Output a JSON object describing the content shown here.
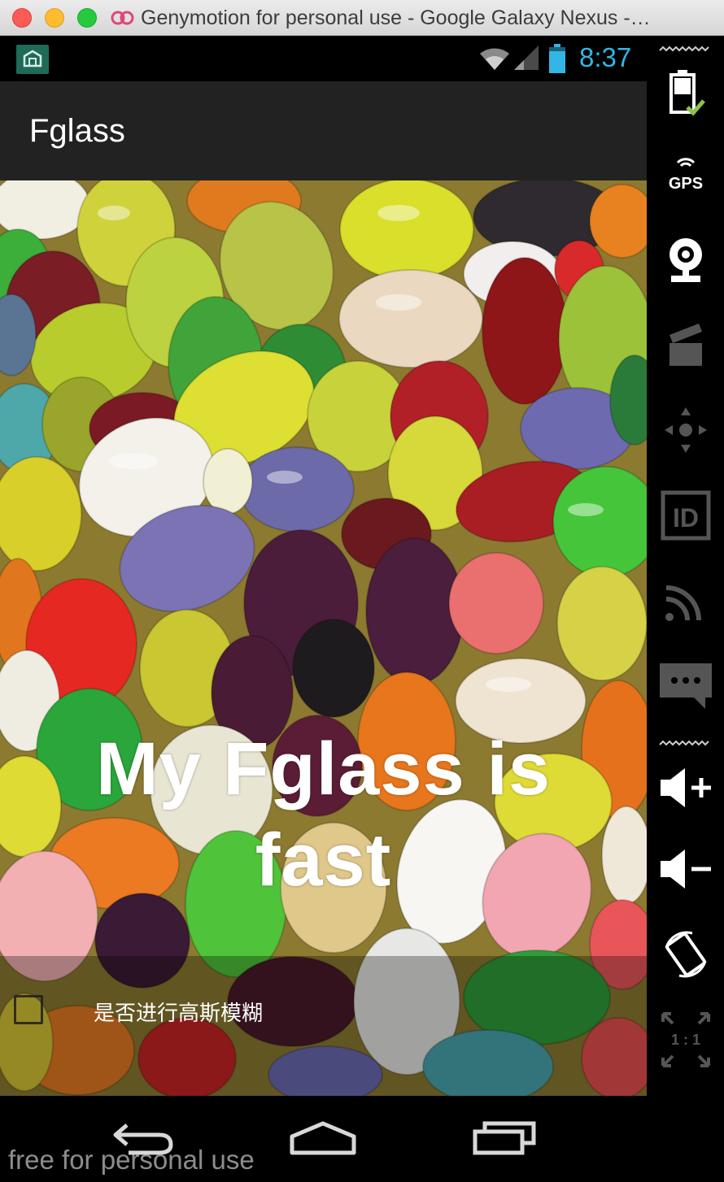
{
  "window": {
    "title": "Genymotion for personal use - Google Galaxy Nexus -…"
  },
  "statusbar": {
    "time": "8:37",
    "accent_color": "#33b5e5"
  },
  "app": {
    "title": "Fglass",
    "overlay_line1": "My Fglass is",
    "overlay_line2": "fast",
    "blur_checkbox": {
      "label": "是否进行高斯模糊",
      "checked": false
    }
  },
  "navbar": {
    "watermark": "free for personal use"
  },
  "toolbar": {
    "items": [
      {
        "icon": "battery-icon"
      },
      {
        "icon": "gps-icon",
        "label": "GPS"
      },
      {
        "icon": "webcam-icon"
      },
      {
        "icon": "clapperboard-icon"
      },
      {
        "icon": "dpad-icon"
      },
      {
        "icon": "id-icon",
        "label": "ID"
      },
      {
        "icon": "network-icon"
      },
      {
        "icon": "sms-icon"
      },
      {
        "icon": "volume-up-icon"
      },
      {
        "icon": "volume-down-icon"
      },
      {
        "icon": "rotate-icon"
      },
      {
        "icon": "pixel-perfect-icon",
        "label": "1 : 1"
      }
    ]
  }
}
